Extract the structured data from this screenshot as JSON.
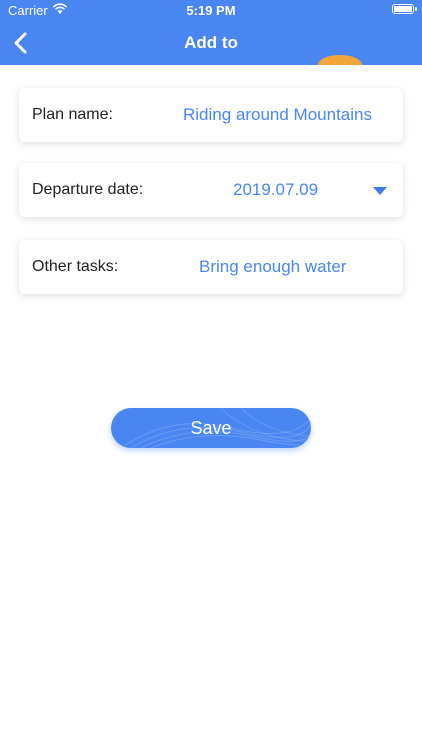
{
  "status_bar": {
    "carrier": "Carrier",
    "time": "5:19 PM"
  },
  "header": {
    "title": "Add to",
    "back_icon": "chevron-left-icon",
    "accent": "#4a86f1"
  },
  "form": {
    "plan_name": {
      "label": "Plan name:",
      "value": "Riding around Mountains"
    },
    "departure_date": {
      "label": "Departure date:",
      "value": "2019.07.09",
      "icon": "dropdown-triangle-icon"
    },
    "other_tasks": {
      "label": "Other tasks:",
      "value": "Bring enough water"
    }
  },
  "save_button": {
    "label": "Save"
  }
}
